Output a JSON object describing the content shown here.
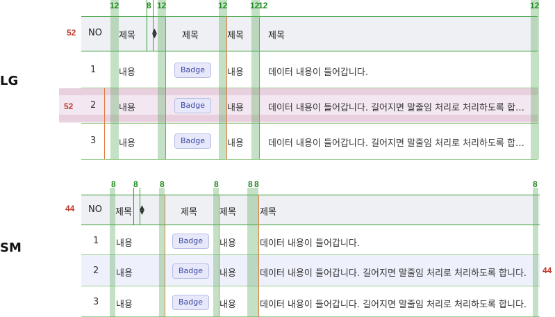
{
  "labels": {
    "lg": "LG",
    "sm": "SM"
  },
  "lg": {
    "header": {
      "no": "NO",
      "col1": "제목",
      "col2": "제목",
      "col3": "제목",
      "col4": "제목"
    },
    "rows": [
      {
        "no": "1",
        "col1": "내용",
        "badge": "Badge",
        "col3": "내용",
        "text": "데이터 내용이 들어갑니다."
      },
      {
        "no": "2",
        "col1": "내용",
        "badge": "Badge",
        "col3": "내용",
        "text": "데이터 내용이 들어갑니다. 길어지면 말줄임 처리로 처리하도록 합…"
      },
      {
        "no": "3",
        "col1": "내용",
        "badge": "Badge",
        "col3": "내용",
        "text": "데이터 내용이 들어갑니다. 길어지면 말줄임 처리로 처리하도록 합…"
      }
    ],
    "dims": {
      "header_height": "52",
      "row_height": "52"
    },
    "gaps": [
      "12",
      "8",
      "12",
      "12",
      "12",
      "12",
      "12"
    ]
  },
  "sm": {
    "header": {
      "no": "NO",
      "col1": "제목",
      "col2": "제목",
      "col3": "제목",
      "col4": "제목"
    },
    "rows": [
      {
        "no": "1",
        "col1": "내용",
        "badge": "Badge",
        "col3": "내용",
        "text": "데이터 내용이 들어갑니다."
      },
      {
        "no": "2",
        "col1": "내용",
        "badge": "Badge",
        "col3": "내용",
        "text": "데이터 내용이 들어갑니다. 길어지면 말줄임 처리로 처리하도록 합니다."
      },
      {
        "no": "3",
        "col1": "내용",
        "badge": "Badge",
        "col3": "내용",
        "text": "데이터 내용이 들어갑니다. 길어지면 말줄임 처리로 처리하도록 합니다."
      }
    ],
    "dims": {
      "header_height": "44",
      "row_height": "44"
    },
    "gaps": [
      "8",
      "8",
      "8",
      "8",
      "8",
      "8",
      "8"
    ]
  },
  "icons": {
    "sort": "sort-updown-icon"
  },
  "colors": {
    "spacing_band": "#8cc98c",
    "header_bg": "#eef0f3",
    "highlight_row": "#eef0fb",
    "measure_red": "#c0392b",
    "measure_green": "#1f8a1f"
  }
}
